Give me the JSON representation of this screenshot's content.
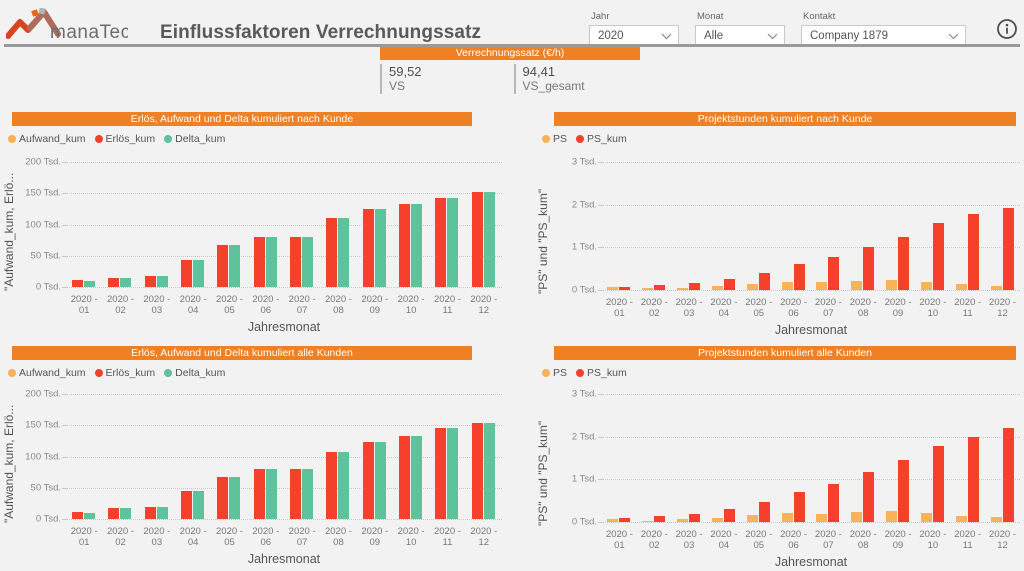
{
  "header": {
    "logo_text": "manaTec",
    "title": "Einflussfaktoren Verrechnungssatz",
    "info_icon": "info-icon",
    "filters": [
      {
        "label": "Jahr",
        "value": "2020",
        "icon": "chevron-down-icon"
      },
      {
        "label": "Monat",
        "value": "Alle",
        "icon": "chevron-down-icon"
      },
      {
        "label": "Kontakt",
        "value": "Company 1879",
        "icon": "chevron-down-icon"
      }
    ]
  },
  "kpi": {
    "title": "Verrechnungssatz (€/h)",
    "items": [
      {
        "value": "59,52",
        "label": "VS"
      },
      {
        "value": "94,41",
        "label": "VS_gesamt"
      }
    ]
  },
  "colors": {
    "accent": "#ef8023",
    "aufwand_kum": "#f9b15a",
    "erloes_kum": "#f5402c",
    "delta_kum": "#5cc39b",
    "ps": "#f9b15a",
    "ps_kum": "#f5402c",
    "grid": "#c9c9c9",
    "panel_bg": "#f2f2f2"
  },
  "chart_data": [
    {
      "id": "erloes-aufwand-delta-nach-kunde",
      "type": "bar",
      "title": "Erlös, Aufwand und Delta kumuliert nach Kunde",
      "xlabel": "Jahresmonat",
      "ylabel": "\"Aufwand_kum, Erlö...",
      "ylim": [
        0,
        200000
      ],
      "yticks": [
        0,
        50000,
        100000,
        150000,
        200000
      ],
      "ytick_labels": [
        "0 Tsd.",
        "50 Tsd.",
        "100 Tsd.",
        "150 Tsd.",
        "200 Tsd."
      ],
      "grid": true,
      "legend_position": "top-left",
      "categories": [
        "2020 - 01",
        "2020 - 02",
        "2020 - 03",
        "2020 - 04",
        "2020 - 05",
        "2020 - 06",
        "2020 - 07",
        "2020 - 08",
        "2020 - 09",
        "2020 - 10",
        "2020 - 11",
        "2020 - 12"
      ],
      "series": [
        {
          "name": "Aufwand_kum",
          "color": "#f9b15a",
          "values": [
            0,
            0,
            0,
            0,
            0,
            0,
            0,
            0,
            0,
            0,
            0,
            0
          ]
        },
        {
          "name": "Erlös_kum",
          "color": "#f5402c",
          "values": [
            11000,
            15000,
            18000,
            43000,
            67000,
            80000,
            80000,
            111000,
            125000,
            133000,
            143000,
            152000
          ]
        },
        {
          "name": "Delta_kum",
          "color": "#5cc39b",
          "values": [
            10000,
            15000,
            18000,
            43000,
            67000,
            80000,
            80000,
            111000,
            125000,
            133000,
            143000,
            152000
          ]
        }
      ]
    },
    {
      "id": "projektstunden-nach-kunde",
      "type": "bar",
      "title": "Projektstunden kumuliert nach Kunde",
      "xlabel": "Jahresmonat",
      "ylabel": "\"PS\" und \"PS_kum\"",
      "ylim": [
        0,
        3000
      ],
      "yticks": [
        0,
        1000,
        2000,
        3000
      ],
      "ytick_labels": [
        "0 Tsd.",
        "1 Tsd.",
        "2 Tsd.",
        "3 Tsd."
      ],
      "grid": true,
      "legend_position": "top-left",
      "categories": [
        "2020 - 01",
        "2020 - 02",
        "2020 - 03",
        "2020 - 04",
        "2020 - 05",
        "2020 - 06",
        "2020 - 07",
        "2020 - 08",
        "2020 - 09",
        "2020 - 10",
        "2020 - 11",
        "2020 - 12"
      ],
      "series": [
        {
          "name": "PS",
          "color": "#f9b15a",
          "values": [
            75,
            40,
            55,
            90,
            150,
            185,
            180,
            205,
            225,
            190,
            130,
            105
          ]
        },
        {
          "name": "PS_kum",
          "color": "#f5402c",
          "values": [
            75,
            115,
            170,
            260,
            410,
            600,
            780,
            1010,
            1240,
            1560,
            1770,
            1930
          ]
        }
      ]
    },
    {
      "id": "erloes-aufwand-delta-alle-kunden",
      "type": "bar",
      "title": "Erlös, Aufwand und Delta kumuliert alle Kunden",
      "xlabel": "Jahresmonat",
      "ylabel": "\"Aufwand_kum, Erlö...",
      "ylim": [
        0,
        200000
      ],
      "yticks": [
        0,
        50000,
        100000,
        150000,
        200000
      ],
      "ytick_labels": [
        "0 Tsd.",
        "50 Tsd.",
        "100 Tsd.",
        "150 Tsd.",
        "200 Tsd."
      ],
      "grid": true,
      "legend_position": "top-left",
      "categories": [
        "2020 - 01",
        "2020 - 02",
        "2020 - 03",
        "2020 - 04",
        "2020 - 05",
        "2020 - 06",
        "2020 - 07",
        "2020 - 08",
        "2020 - 09",
        "2020 - 10",
        "2020 - 11",
        "2020 - 12"
      ],
      "series": [
        {
          "name": "Aufwand_kum",
          "color": "#f9b15a",
          "values": [
            0,
            0,
            0,
            0,
            0,
            0,
            0,
            0,
            0,
            0,
            0,
            0
          ]
        },
        {
          "name": "Erlös_kum",
          "color": "#f5402c",
          "values": [
            11000,
            17000,
            19000,
            45000,
            68000,
            80000,
            80000,
            108000,
            123000,
            133000,
            145000,
            153000
          ]
        },
        {
          "name": "Delta_kum",
          "color": "#5cc39b",
          "values": [
            10000,
            17000,
            19000,
            45000,
            68000,
            80000,
            80000,
            108000,
            123000,
            133000,
            145000,
            153000
          ]
        }
      ]
    },
    {
      "id": "projektstunden-alle-kunden",
      "type": "bar",
      "title": "Projektstunden kumuliert alle Kunden",
      "xlabel": "Jahresmonat",
      "ylabel": "\"PS\" und \"PS_kum\"",
      "ylim": [
        0,
        3000
      ],
      "yticks": [
        0,
        1000,
        2000,
        3000
      ],
      "ytick_labels": [
        "0 Tsd.",
        "1 Tsd.",
        "2 Tsd.",
        "3 Tsd."
      ],
      "grid": true,
      "legend_position": "top-left",
      "categories": [
        "2020 - 01",
        "2020 - 02",
        "2020 - 03",
        "2020 - 04",
        "2020 - 05",
        "2020 - 06",
        "2020 - 07",
        "2020 - 08",
        "2020 - 09",
        "2020 - 10",
        "2020 - 11",
        "2020 - 12"
      ],
      "series": [
        {
          "name": "PS",
          "color": "#f9b15a",
          "values": [
            80,
            35,
            60,
            95,
            155,
            200,
            185,
            230,
            250,
            205,
            140,
            110
          ]
        },
        {
          "name": "PS_kum",
          "color": "#f5402c",
          "values": [
            90,
            130,
            190,
            300,
            480,
            700,
            900,
            1180,
            1450,
            1770,
            2000,
            2200
          ]
        }
      ]
    }
  ]
}
